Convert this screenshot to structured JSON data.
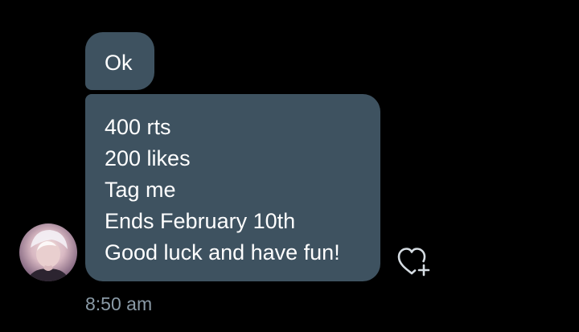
{
  "conversation": {
    "messages": [
      {
        "lines": [
          "Ok"
        ]
      },
      {
        "lines": [
          "400 rts",
          "200 likes",
          "Tag me",
          "Ends February 10th",
          "Good luck and have fun!"
        ]
      }
    ],
    "timestamp": "8:50 am",
    "sender_avatar_icon": "user-avatar",
    "react_icon": "heart-plus-icon"
  },
  "colors": {
    "background": "#000000",
    "bubble": "#3e5260",
    "message_text": "#ffffff",
    "timestamp_text": "#8a9aa6",
    "icon_stroke": "#d5dce2"
  }
}
